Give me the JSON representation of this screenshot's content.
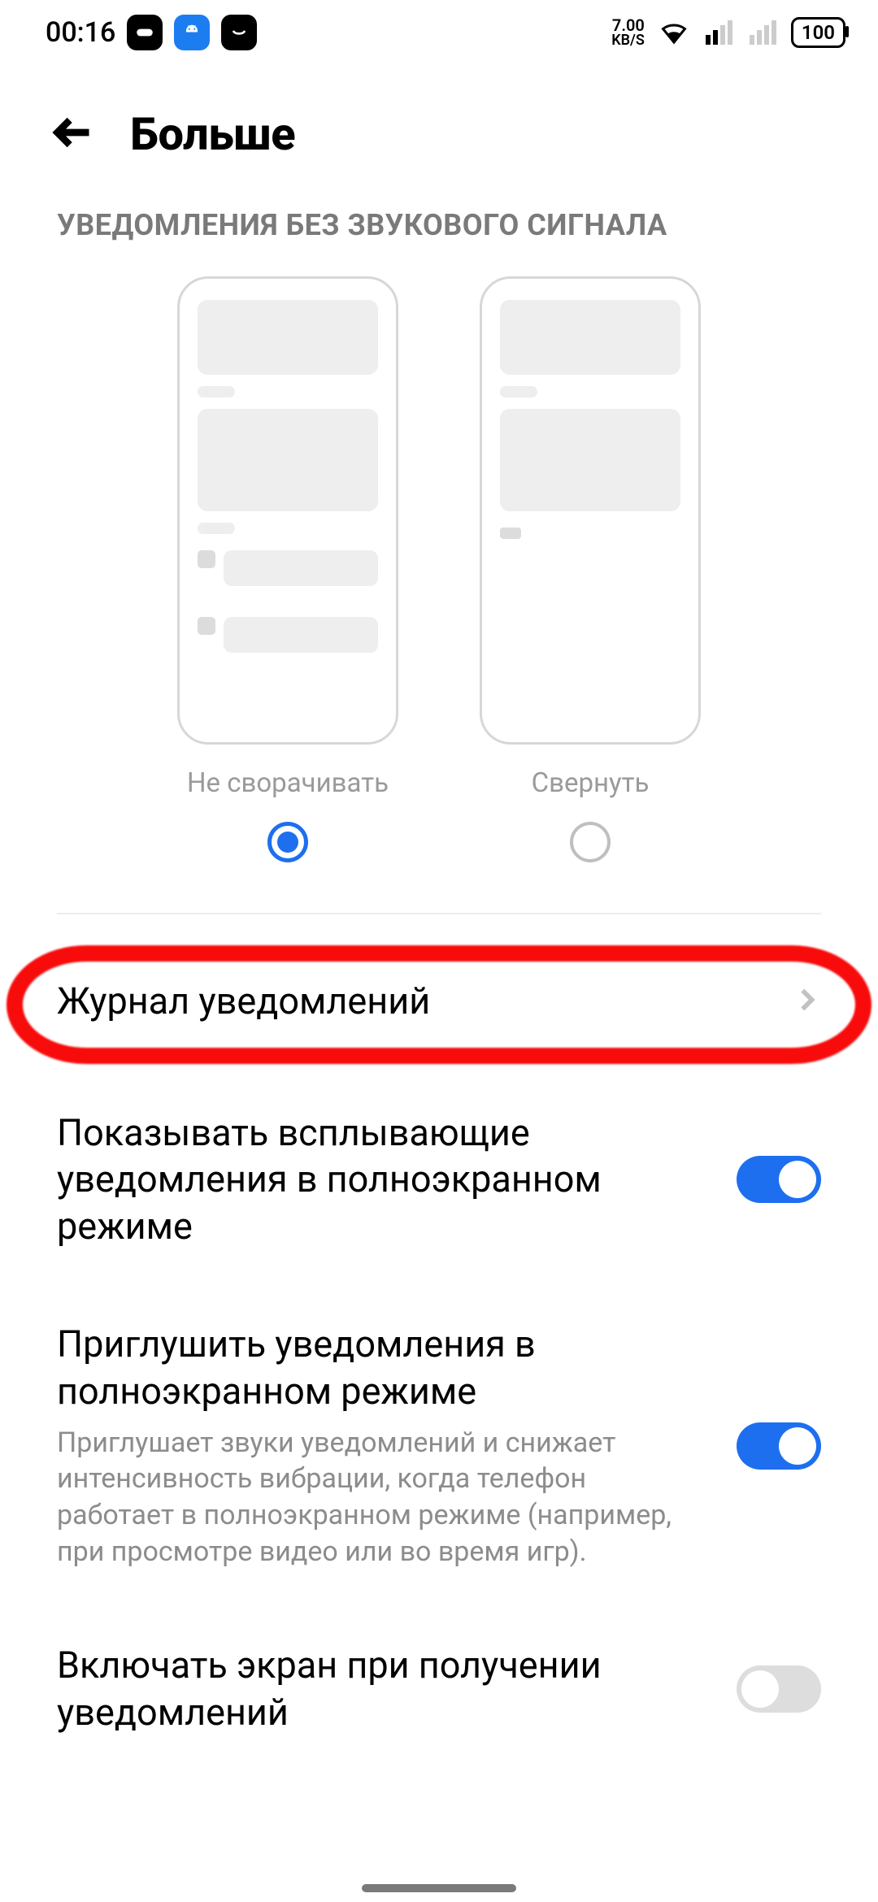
{
  "statusbar": {
    "time": "00:16",
    "net_value": "7.00",
    "net_unit": "KB/S",
    "battery": "100"
  },
  "header": {
    "title": "Больше"
  },
  "section": {
    "label": "УВЕДОМЛЕНИЯ БЕЗ ЗВУКОВОГО СИГНАЛА",
    "options": [
      {
        "label": "Не сворачивать",
        "selected": true
      },
      {
        "label": "Свернуть",
        "selected": false
      }
    ]
  },
  "items": {
    "journal": {
      "title": "Журнал уведомлений"
    },
    "popup_fullscreen": {
      "title": "Показывать всплывающие уведомления в полноэкранном режиме",
      "on": true
    },
    "mute_fullscreen": {
      "title": "Приглушить уведомления в полноэкранном режиме",
      "sub": "Приглушает звуки уведомлений и снижает интенсивность вибрации, когда телефон работает в полноэкранном режиме (например, при просмотре видео или во время игр).",
      "on": true
    },
    "wake_screen": {
      "title": "Включать экран при получении уведомлений",
      "on": false
    }
  }
}
